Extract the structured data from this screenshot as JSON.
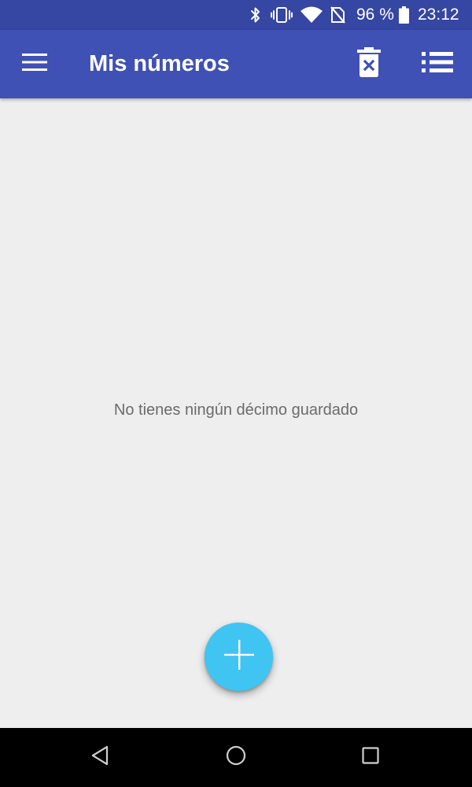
{
  "status_bar": {
    "icons": [
      "bluetooth-icon",
      "vibrate-icon",
      "wifi-icon",
      "no-sim-icon",
      "battery-icon"
    ],
    "battery_percent": "96 %",
    "time": "23:12"
  },
  "app_bar": {
    "menu_icon": "menu-icon",
    "title": "Mis números",
    "actions": [
      "delete-all-icon",
      "list-icon"
    ]
  },
  "main": {
    "empty_message": "No tienes ningún décimo guardado"
  },
  "fab": {
    "icon": "plus-icon"
  },
  "nav_bar": {
    "buttons": [
      "back-icon",
      "home-icon",
      "recents-icon"
    ]
  },
  "colors": {
    "status_bar": "#3546a3",
    "app_bar": "#3f51b5",
    "background": "#eeeeef",
    "fab": "#40c4f2",
    "empty_text": "#6b6b6b",
    "nav_bar": "#000000"
  }
}
